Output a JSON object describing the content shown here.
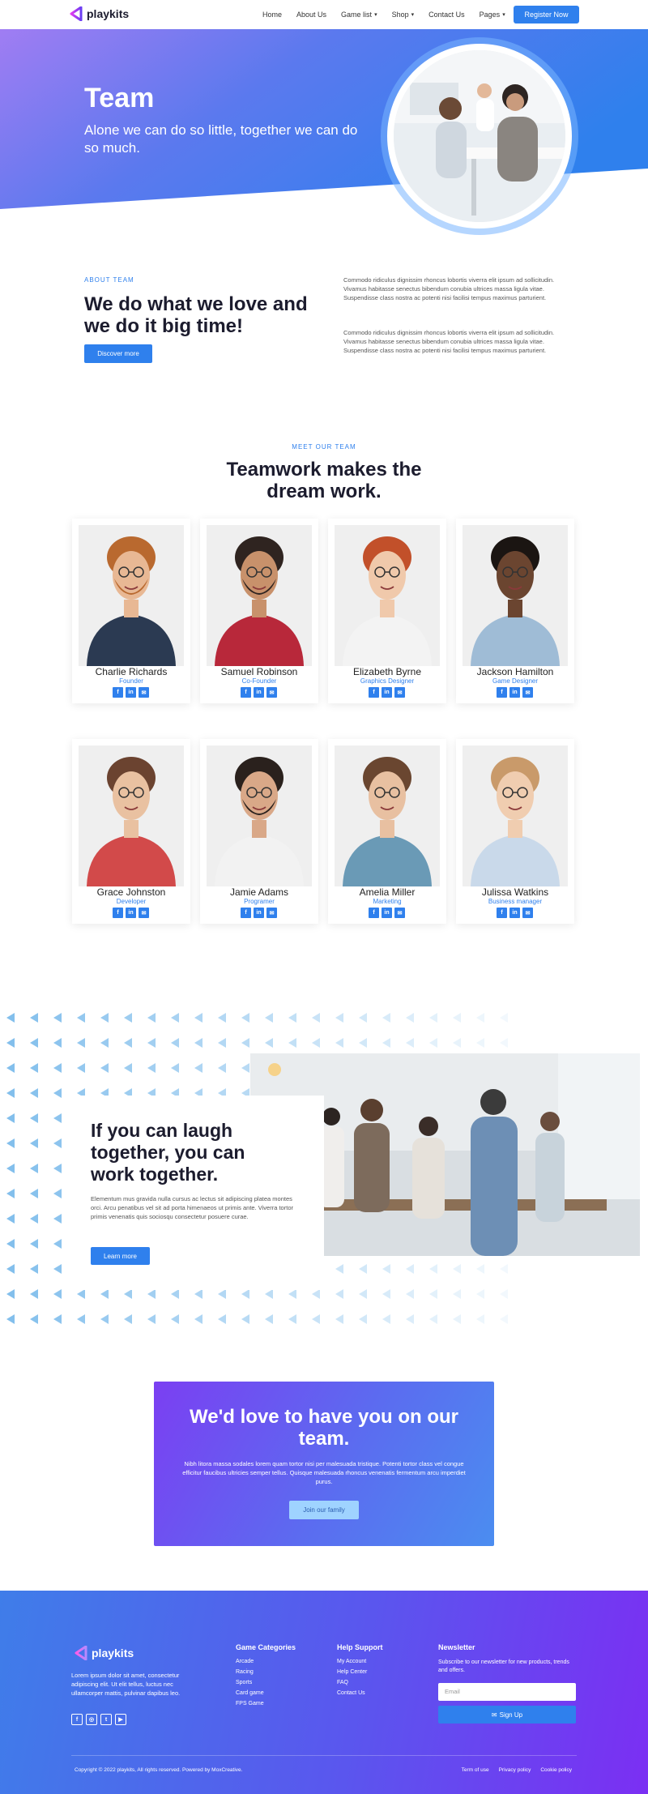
{
  "nav": {
    "logo": "playkits",
    "links": [
      {
        "label": "Home",
        "dropdown": false
      },
      {
        "label": "About Us",
        "dropdown": false
      },
      {
        "label": "Game list",
        "dropdown": true
      },
      {
        "label": "Shop",
        "dropdown": true
      },
      {
        "label": "Contact Us",
        "dropdown": false
      },
      {
        "label": "Pages",
        "dropdown": true
      }
    ],
    "cta": "Register Now"
  },
  "hero": {
    "title": "Team",
    "subtitle": "Alone we can do so little, together we can do so much."
  },
  "about": {
    "eyebrow": "ABOUT TEAM",
    "title": "We do what we love and we do it big time!",
    "button": "Discover more",
    "p1": "Commodo ridiculus dignissim rhoncus lobortis viverra elit ipsum ad sollicitudin. Vivamus habitasse senectus bibendum conubia ultrices massa ligula vitae. Suspendisse class nostra ac potenti nisi facilisi tempus maximus parturient.",
    "p2": "Commodo ridiculus dignissim rhoncus lobortis viverra elit ipsum ad sollicitudin. Vivamus habitasse senectus bibendum conubia ultrices massa ligula vitae. Suspendisse class nostra ac potenti nisi facilisi tempus maximus parturient."
  },
  "team": {
    "eyebrow": "MEET OUR TEAM",
    "title": "Teamwork makes the dream work.",
    "members": [
      {
        "name": "Charlie Richards",
        "role": "Founder"
      },
      {
        "name": "Samuel Robinson",
        "role": "Co-Founder"
      },
      {
        "name": "Elizabeth Byrne",
        "role": "Graphics Designer"
      },
      {
        "name": "Jackson Hamilton",
        "role": "Game Designer"
      },
      {
        "name": "Grace Johnston",
        "role": "Developer"
      },
      {
        "name": "Jamie Adams",
        "role": "Programer"
      },
      {
        "name": "Amelia Miller",
        "role": "Marketing"
      },
      {
        "name": "Julissa Watkins",
        "role": "Business manager"
      }
    ],
    "social": [
      "f",
      "in",
      "✉"
    ]
  },
  "laugh": {
    "title": "If you can laugh together, you can work together.",
    "text": "Elementum mus gravida nulla cursus ac lectus sit adipiscing platea montes orci. Arcu penatibus vel sit ad porta himenaeos ut primis ante. Viverra tortor primis venenatis quis sociosqu consectetur posuere curae.",
    "button": "Learn more"
  },
  "cta": {
    "title": "We'd love to have you on our team.",
    "text": "Nibh litora massa sodales lorem quam tortor nisi per malesuada tristique. Potenti tortor class vel congue efficitur faucibus ultricies semper tellus. Quisque malesuada rhoncus venenatis fermentum arcu imperdiet purus.",
    "button": "Join our family"
  },
  "footer": {
    "logo": "playkits",
    "description": "Lorem ipsum dolor sit amet, consectetur adipiscing elit. Ut elit tellus, luctus nec ullamcorper mattis, pulvinar dapibus leo.",
    "social": [
      "f",
      "◎",
      "t",
      "▶"
    ],
    "col1": {
      "title": "Game Categories",
      "items": [
        "Arcade",
        "Racing",
        "Sports",
        "Card game",
        "FPS Game"
      ]
    },
    "col2": {
      "title": "Help Support",
      "items": [
        "My Account",
        "Help Center",
        "FAQ",
        "Contact Us"
      ]
    },
    "newsletter": {
      "title": "Newsletter",
      "text": "Subscribe to our newsletter for new products, trends and offers.",
      "placeholder": "Email",
      "button": "Sign Up"
    },
    "copyright": "Copyright © 2022 playkits, All rights reserved. Powered by MoxCreative.",
    "links": [
      "Term of use",
      "Privacy policy",
      "Cookie policy"
    ]
  },
  "colors": {
    "accent": "#2f80ed",
    "hero_start": "#9b7cf0",
    "hero_end": "#2f80ed",
    "purple": "#7b2ff3"
  }
}
